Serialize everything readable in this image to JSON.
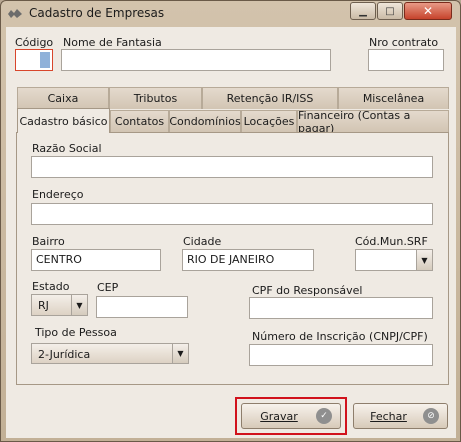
{
  "window": {
    "title": "Cadastro de Empresas"
  },
  "header": {
    "codigo_label": "Código",
    "codigo_value": "",
    "fantasia_label": "Nome de Fantasia",
    "fantasia_value": "",
    "contrato_label": "Nro contrato",
    "contrato_value": ""
  },
  "tabs": {
    "row1": [
      "Caixa",
      "Tributos",
      "Retenção IR/ISS",
      "Miscelânea"
    ],
    "row2": [
      "Cadastro básico",
      "Contatos",
      "Condomínios",
      "Locações",
      "Financeiro (Contas a pagar)"
    ],
    "active": "Cadastro básico"
  },
  "form": {
    "razao_label": "Razão Social",
    "razao_value": "",
    "endereco_label": "Endereço",
    "endereco_value": "",
    "bairro_label": "Bairro",
    "bairro_value": "CENTRO",
    "cidade_label": "Cidade",
    "cidade_value": "RIO DE JANEIRO",
    "codmun_label": "Cód.Mun.SRF",
    "codmun_value": "",
    "estado_label": "Estado",
    "estado_value": "RJ",
    "cep_label": "CEP",
    "cep_value": "",
    "cpf_label": "CPF do Responsável",
    "cpf_value": "",
    "tipo_label": "Tipo de Pessoa",
    "tipo_value": "2-Jurídica",
    "inscricao_label": "Número de Inscrição (CNPJ/CPF)",
    "inscricao_value": ""
  },
  "buttons": {
    "gravar": "Gravar",
    "fechar": "Fechar"
  },
  "colors": {
    "highlight": "#d1121c",
    "chrome": "#c6b59d",
    "focus": "#d8462c"
  }
}
